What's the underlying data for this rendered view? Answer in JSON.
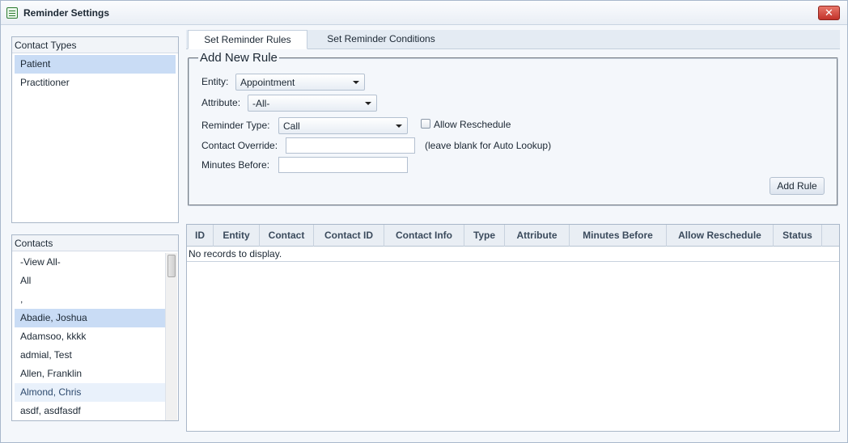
{
  "window": {
    "title": "Reminder Settings",
    "close_label": "✕"
  },
  "contact_types": {
    "header": "Contact Types",
    "items": [
      {
        "label": "Patient",
        "selected": true
      },
      {
        "label": "Practitioner",
        "selected": false
      }
    ]
  },
  "contacts": {
    "header": "Contacts",
    "items": [
      {
        "label": "-View All-"
      },
      {
        "label": "All"
      },
      {
        "label": ","
      },
      {
        "label": "Abadie, Joshua"
      },
      {
        "label": "Adamsoo, kkkk"
      },
      {
        "label": "admial, Test"
      },
      {
        "label": "Allen, Franklin"
      },
      {
        "label": "Almond, Chris"
      },
      {
        "label": "asdf, asdfasdf"
      }
    ]
  },
  "tabs": [
    {
      "label": "Set Reminder Rules",
      "active": true
    },
    {
      "label": "Set Reminder Conditions",
      "active": false
    }
  ],
  "form": {
    "legend": "Add New Rule",
    "entity_label": "Entity:",
    "entity_value": "Appointment",
    "attribute_label": "Attribute:",
    "attribute_value": "-All-",
    "reminder_type_label": "Reminder Type:",
    "reminder_type_value": "Call",
    "allow_reschedule_label": "Allow Reschedule",
    "allow_reschedule_checked": false,
    "contact_override_label": "Contact Override:",
    "contact_override_value": "",
    "contact_override_hint": "(leave blank for Auto Lookup)",
    "minutes_before_label": "Minutes Before:",
    "minutes_before_value": "",
    "add_rule_label": "Add Rule"
  },
  "grid": {
    "columns": [
      "ID",
      "Entity",
      "Contact",
      "Contact ID",
      "Contact Info",
      "Type",
      "Attribute",
      "Minutes Before",
      "Allow Reschedule",
      "Status"
    ],
    "empty_message": "No records to display."
  }
}
